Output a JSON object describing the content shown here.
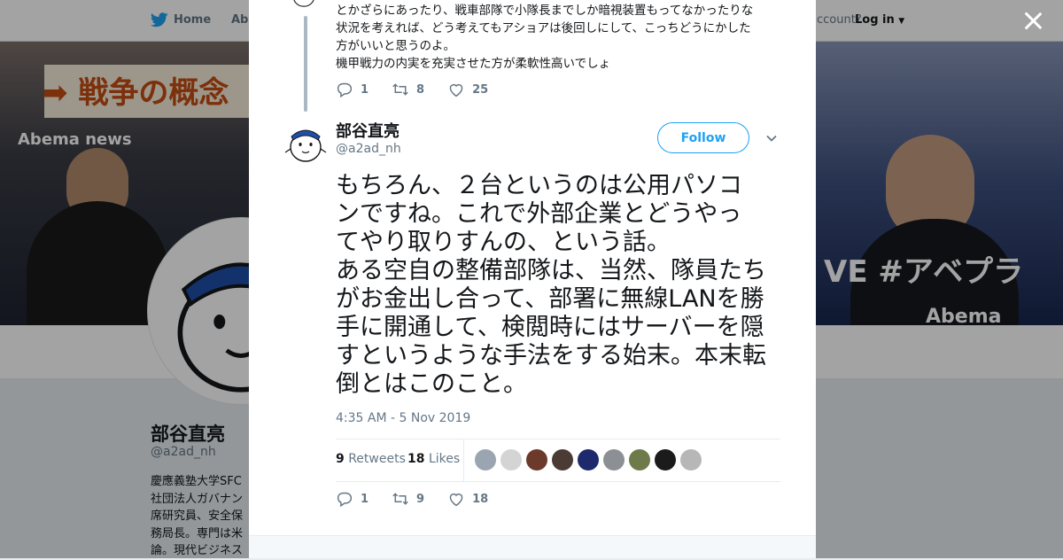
{
  "nav": {
    "home_label": "Home",
    "about_label": "Abo",
    "account_label": "ccount?",
    "login_label": "Log in"
  },
  "banner": {
    "sign_text": "➡ 戦争の概念",
    "abema_text": "Abema news",
    "live_text": "VE #アベプラ",
    "abema2_text": "Abema"
  },
  "profile": {
    "name": "部谷直亮",
    "handle": "@a2ad_nh",
    "bio_lines": [
      "慶應義塾大学SFC",
      "社団法人ガバナン",
      "席研究員、安全保",
      "務局長。専門は米",
      "論。現代ビジネス"
    ]
  },
  "previous_tweet": {
    "text_lines": [
      "とかざらにあったり、戦車部隊で小隊長までしか暗視装置もってなかったりな",
      "状況を考えれば、どう考えてもアショアは後回しにして、こっちどうにかした",
      "方がいいと思うのよ。",
      "機甲戦力の内実を充実させた方が柔軟性高いでしょ"
    ],
    "replies": "1",
    "retweets": "8",
    "likes": "25"
  },
  "tweet": {
    "author_name": "部谷直亮",
    "author_handle": "@a2ad_nh",
    "follow_label": "Follow",
    "text_lines": [
      "もちろん、２台というのは公用パソコ",
      "ンですね。これで外部企業とどうやっ",
      "てやり取りすんの、という話。",
      "ある空自の整備部隊は、当然、隊員たち",
      "がお金出し合って、部署に無線LANを勝",
      "手に開通して、検閲時にはサーバーを隠",
      "すというような手法をする始末。本末転",
      "倒とはこのこと。"
    ],
    "timestamp": "4:35 AM - 5 Nov 2019",
    "retweet_count": "9",
    "retweet_label": "Retweets",
    "like_count": "18",
    "like_label": "Likes",
    "replies": "1",
    "retweets": "9",
    "likes": "18"
  },
  "colors": {
    "brand_blue": "#1da1f2",
    "muted_gray": "#657786",
    "thread_line": "#aab8c2"
  },
  "icons": [
    "twitter-bird-icon",
    "reply-icon",
    "retweet-icon",
    "like-icon",
    "close-icon",
    "chevron-down-icon"
  ]
}
